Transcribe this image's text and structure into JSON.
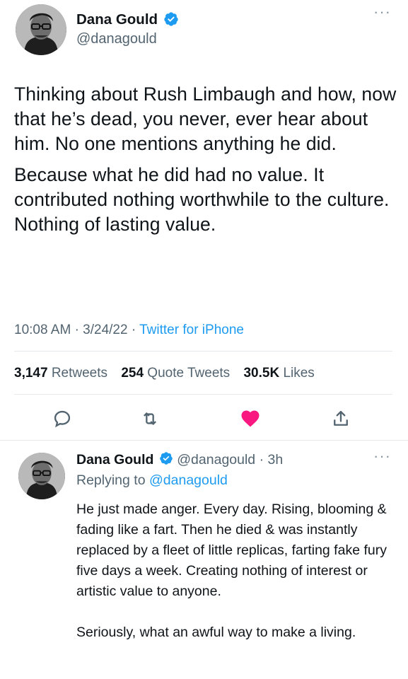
{
  "main_tweet": {
    "author_name": "Dana Gould",
    "author_handle": "@danagould",
    "paragraphs": [
      "Thinking about Rush Limbaugh and how, now that he’s dead, you never, ever hear about him. No one mentions anything he did.",
      "Because what he did had no value. It contributed nothing worthwhile to the culture. Nothing of lasting value."
    ],
    "time": "10:08 AM",
    "date": "3/24/22",
    "source": "Twitter for iPhone",
    "stats": {
      "retweets_count": "3,147",
      "retweets_label": "Retweets",
      "quotes_count": "254",
      "quotes_label": "Quote Tweets",
      "likes_count": "30.5K",
      "likes_label": "Likes"
    },
    "actions": {
      "reply_icon": "reply-icon",
      "retweet_icon": "retweet-icon",
      "like_icon": "heart-icon",
      "share_icon": "share-icon",
      "like_color": "#f91880"
    }
  },
  "reply_tweet": {
    "author_name": "Dana Gould",
    "author_handle": "@danagould",
    "separator": "·",
    "age": "3h",
    "replying_prefix": "Replying to",
    "replying_to": "@danagould",
    "paragraphs": [
      "He just made anger. Every day. Rising, blooming & fading like a fart. Then he died & was instantly replaced by a fleet of little replicas, farting fake fury five days a week. Creating nothing of interest or artistic value to anyone.",
      "Seriously, what an awful way to make a living."
    ]
  },
  "colors": {
    "accent": "#1d9bf0",
    "text": "#0f1419",
    "secondary": "#536471",
    "heart": "#f91880"
  }
}
